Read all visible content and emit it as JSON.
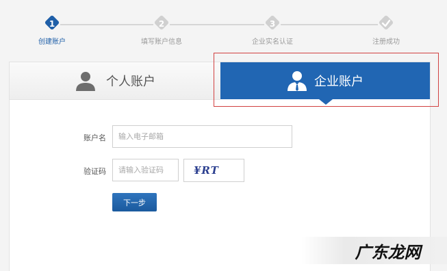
{
  "steps": [
    {
      "number": "1",
      "label": "创建账户",
      "active": true
    },
    {
      "number": "2",
      "label": "填写账户信息",
      "active": false
    },
    {
      "number": "3",
      "label": "企业实名认证",
      "active": false
    },
    {
      "number": "",
      "label": "注册成功",
      "active": false,
      "icon": "check-icon"
    }
  ],
  "tabs": {
    "personal": {
      "label": "个人账户",
      "icon": "person-icon"
    },
    "enterprise": {
      "label": "企业账户",
      "icon": "business-person-icon",
      "selected": true
    }
  },
  "form": {
    "account_label": "账户名",
    "account_placeholder": "输入电子邮箱",
    "captcha_label": "验证码",
    "captcha_placeholder": "请输入验证码",
    "captcha_image_text": "¥RT",
    "next_button": "下一步"
  },
  "watermark": {
    "text": "广东龙网"
  },
  "colors": {
    "accent": "#2166b3",
    "step_active": "#1f5fa8",
    "step_inactive": "#d0d0d0",
    "highlight": "#d14040"
  }
}
